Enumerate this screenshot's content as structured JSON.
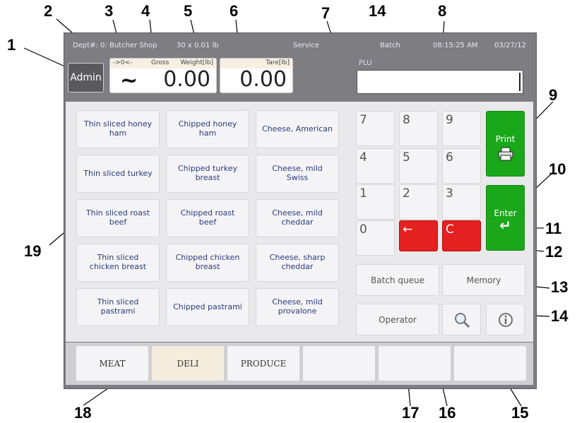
{
  "status": {
    "dept": "Dept#: 0: Butcher Shop",
    "capacity": "30 x 0.01 lb",
    "mode": "Service",
    "batch": "Batch",
    "time": "08:15:25 AM",
    "date": "03/27/12"
  },
  "admin_label": "Admin",
  "gross": {
    "indicator": "->0<-",
    "label": "Gross",
    "unit_label": "Weight[lb]",
    "stable_symbol": "~",
    "value": "0.00"
  },
  "tare": {
    "label": "Tare[lb]",
    "value": "0.00"
  },
  "plu": {
    "label": "PLU",
    "value": ""
  },
  "products": [
    [
      "Thin sliced honey ham",
      "Chipped honey ham",
      "Cheese, American"
    ],
    [
      "Thin sliced turkey",
      "Chipped turkey breast",
      "Cheese, mild Swiss"
    ],
    [
      "Thin sliced roast beef",
      "Chipped roast beef",
      "Cheese, mild cheddar"
    ],
    [
      "Thin sliced chicken breast",
      "Chipped chicken breast",
      "Cheese, sharp cheddar"
    ],
    [
      "Thin sliced pastrami",
      "Chipped pastrami",
      "Cheese, mild provalone"
    ]
  ],
  "keypad": [
    "7",
    "8",
    "9",
    "4",
    "5",
    "6",
    "1",
    "2",
    "3",
    "0"
  ],
  "backspace_glyph": "←",
  "clear_label": "C",
  "print_label": "Print",
  "enter_label": "Enter",
  "enter_glyph": "↵",
  "batch_queue_label": "Batch queue",
  "memory_label": "Memory",
  "operator_label": "Operator",
  "tabs": [
    "MEAT",
    "DELI",
    "PRODUCE",
    "",
    "",
    ""
  ],
  "selected_tab": "DELI",
  "callouts": [
    "1",
    "2",
    "3",
    "4",
    "5",
    "6",
    "7",
    "14",
    "8",
    "9",
    "10",
    "11",
    "12",
    "13",
    "14",
    "15",
    "16",
    "17",
    "18",
    "19"
  ],
  "icons": [
    "printer-icon",
    "search-icon",
    "info-icon"
  ],
  "colors": {
    "bezel": "#7d7d82",
    "red_key": "#e52020",
    "green_key": "#1aa81a",
    "selected_tab": "#f4ecdc"
  }
}
